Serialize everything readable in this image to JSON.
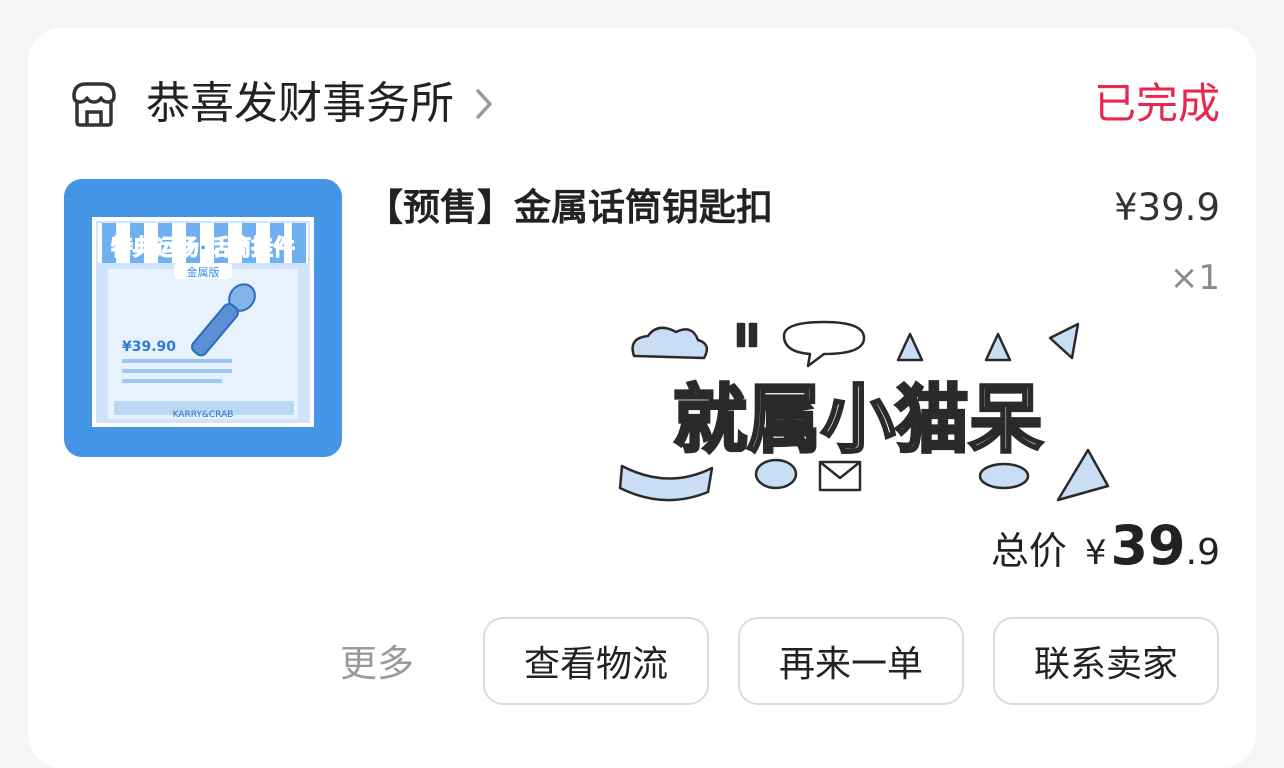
{
  "shop": {
    "name": "恭喜发财事务所",
    "icon": "store-icon"
  },
  "order": {
    "status": "已完成",
    "status_color": "#e8264e"
  },
  "product": {
    "title": "【预售】金属话筒钥匙扣",
    "price": "¥39.9",
    "quantity": "×1",
    "thumbnail": {
      "banner_text": "特典运场·话筒挂件",
      "tag_text": "金属版",
      "price_text": "¥39.90",
      "brand_text": "KARRY&CRAB"
    },
    "sticker_text": "就属小猫呆"
  },
  "total": {
    "label": "总价",
    "currency": "¥",
    "integer": "39",
    "decimal": ".9"
  },
  "actions": {
    "more_label": "更多",
    "logistics_label": "查看物流",
    "reorder_label": "再来一单",
    "contact_label": "联系卖家"
  },
  "colors": {
    "accent": "#e8264e",
    "thumbnail_blue": "#3a8de0"
  }
}
